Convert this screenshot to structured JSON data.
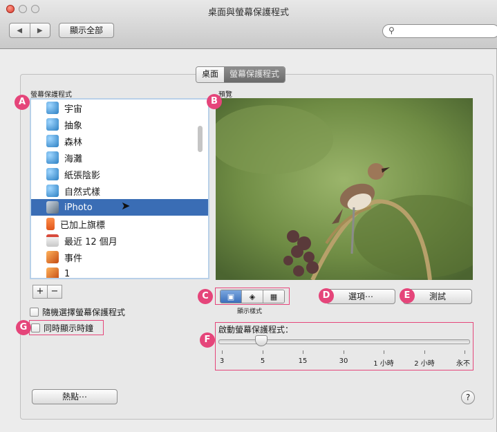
{
  "window": {
    "title": "桌面與螢幕保護程式"
  },
  "toolbar": {
    "back": "◀",
    "forward": "▶",
    "show_all": "顯示全部",
    "search_placeholder": ""
  },
  "tabs": [
    {
      "label": "桌面"
    },
    {
      "label": "螢幕保護程式"
    }
  ],
  "screensaver": {
    "header": "螢幕保護程式",
    "items": [
      {
        "label": "宇宙",
        "icon": "swirl-icon"
      },
      {
        "label": "抽象",
        "icon": "swirl-icon"
      },
      {
        "label": "森林",
        "icon": "swirl-icon"
      },
      {
        "label": "海灘",
        "icon": "swirl-icon"
      },
      {
        "label": "紙張陰影",
        "icon": "swirl-icon"
      },
      {
        "label": "自然式樣",
        "icon": "swirl-icon"
      },
      {
        "label": "iPhoto",
        "icon": "iphoto-icon"
      },
      {
        "label": "已加上旗標",
        "icon": "flag-icon"
      },
      {
        "label": "最近 12 個月",
        "icon": "calendar-icon"
      },
      {
        "label": "事件",
        "icon": "event-icon"
      },
      {
        "label": "1",
        "icon": "event-icon"
      }
    ],
    "selected": "iPhoto",
    "add": "+",
    "remove": "−",
    "random": "隨機選擇螢幕保護程式",
    "show_clock": "同時顯示時鐘"
  },
  "preview": {
    "header": "預覽",
    "modes_label": "顯示樣式"
  },
  "buttons": {
    "options": "選項⋯",
    "test": "測試",
    "hot_corners": "熱點⋯",
    "help": "?"
  },
  "slider": {
    "title": "啟動螢幕保護程式：",
    "ticks": [
      "3",
      "5",
      "15",
      "30",
      "1 小時",
      "2 小時",
      "永不"
    ],
    "selected": "5"
  },
  "callouts": {
    "a": "A",
    "b": "B",
    "c": "C",
    "d": "D",
    "e": "E",
    "f": "F",
    "g": "G"
  },
  "colors": {
    "accent": "#e5457a",
    "selection": "#3a6db5"
  }
}
